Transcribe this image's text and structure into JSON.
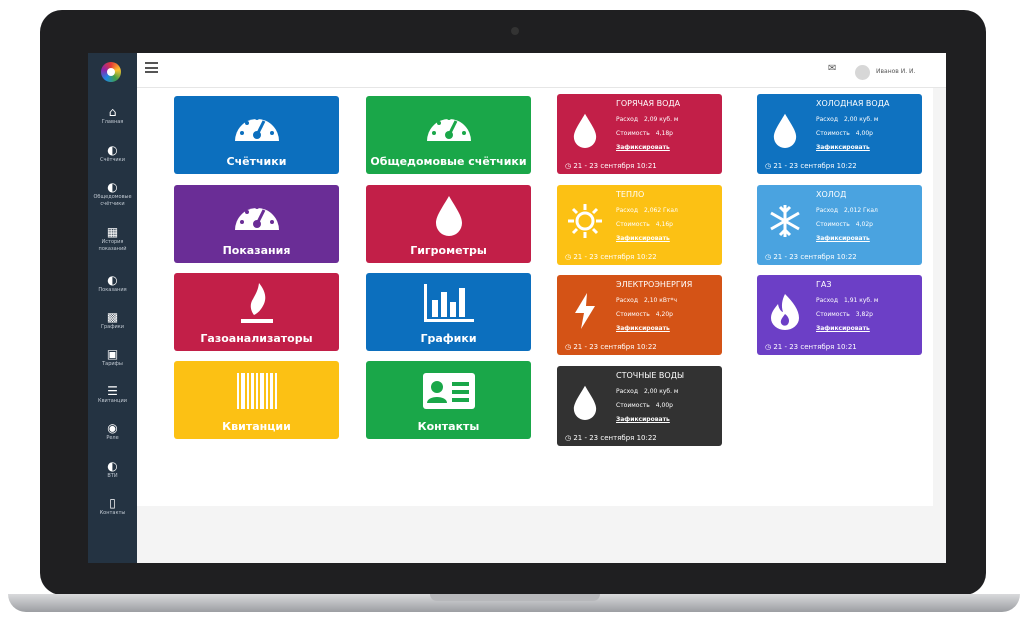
{
  "colors": {
    "blue": "#0c6fbe",
    "green": "#1aa749",
    "purple": "#6a2d96",
    "crimson": "#c21f48",
    "yellow": "#fcc114",
    "orange": "#d45316",
    "dark": "#323232",
    "lightblue": "#0f72c0",
    "skyblue": "#4aa3e0",
    "violet": "#6c3fc6",
    "sidebar": "#243342",
    "accent": "#2ecc71"
  },
  "sidebar": {
    "items": [
      {
        "label": "Главная",
        "icon": "home-icon"
      },
      {
        "label": "Счётчики",
        "icon": "gauge-icon"
      },
      {
        "label": "Общедомовые счётчики",
        "icon": "gauge-icon"
      },
      {
        "label": "История показаний",
        "icon": "calendar-icon"
      },
      {
        "label": "Показания",
        "icon": "gauge-icon"
      },
      {
        "label": "Графики",
        "icon": "chart-icon"
      },
      {
        "label": "Тарифы",
        "icon": "money-icon"
      },
      {
        "label": "Квитанции",
        "icon": "barcode-icon"
      },
      {
        "label": "Реле",
        "icon": "toggle-icon"
      },
      {
        "label": "ВТИ",
        "icon": "gauge-icon"
      },
      {
        "label": "Контакты",
        "icon": "contact-card-icon"
      }
    ]
  },
  "header": {
    "user_name": "Иванов И. И.",
    "menu_icon": "hamburger-icon",
    "mail_icon": "envelope-icon"
  },
  "tiles": [
    {
      "label": "Счётчики",
      "icon": "gauge-icon"
    },
    {
      "label": "Общедомовые счётчики",
      "icon": "gauge-icon"
    },
    {
      "label": "Показания",
      "icon": "gauge-icon"
    },
    {
      "label": "Гигрометры",
      "icon": "drop-icon"
    },
    {
      "label": "Газоанализаторы",
      "icon": "flame-icon"
    },
    {
      "label": "Графики",
      "icon": "bar-chart-icon"
    },
    {
      "label": "Квитанции",
      "icon": "barcode-icon"
    },
    {
      "label": "Контакты",
      "icon": "contact-card-icon"
    }
  ],
  "cards": [
    {
      "title": "ГОРЯЧАЯ ВОДА",
      "usage_label": "Расход",
      "usage": "2,09 куб. м",
      "cost_label": "Стоимость",
      "cost": "4,18р",
      "link": "Зафиксировать",
      "date": "21 - 23 сентября 10:21",
      "icon": "drop-icon"
    },
    {
      "title": "ХОЛОДНАЯ ВОДА",
      "usage_label": "Расход",
      "usage": "2,00 куб. м",
      "cost_label": "Стоимость",
      "cost": "4,00р",
      "link": "Зафиксировать",
      "date": "21 - 23 сентября 10:22",
      "icon": "drop-icon"
    },
    {
      "title": "ТЕПЛО",
      "usage_label": "Расход",
      "usage": "2,062 Гкал",
      "cost_label": "Стоимость",
      "cost": "4,16р",
      "link": "Зафиксировать",
      "date": "21 - 23 сентября 10:22",
      "icon": "sun-icon"
    },
    {
      "title": "ХОЛОД",
      "usage_label": "Расход",
      "usage": "2,012 Гкал",
      "cost_label": "Стоимость",
      "cost": "4,02р",
      "link": "Зафиксировать",
      "date": "21 - 23 сентября 10:22",
      "icon": "snowflake-icon"
    },
    {
      "title": "ЭЛЕКТРОЭНЕРГИЯ",
      "usage_label": "Расход",
      "usage": "2,10 кВт*ч",
      "cost_label": "Стоимость",
      "cost": "4,20р",
      "link": "Зафиксировать",
      "date": "21 - 23 сентября 10:22",
      "icon": "lightning-icon"
    },
    {
      "title": "ГАЗ",
      "usage_label": "Расход",
      "usage": "1,91 куб. м",
      "cost_label": "Стоимость",
      "cost": "3,82р",
      "link": "Зафиксировать",
      "date": "21 - 23 сентября 10:21",
      "icon": "fire-icon"
    },
    {
      "title": "СТОЧНЫЕ ВОДЫ",
      "usage_label": "Расход",
      "usage": "2,00 куб. м",
      "cost_label": "Стоимость",
      "cost": "4,00р",
      "link": "Зафиксировать",
      "date": "21 - 23 сентября 10:22",
      "icon": "drop-icon"
    }
  ]
}
